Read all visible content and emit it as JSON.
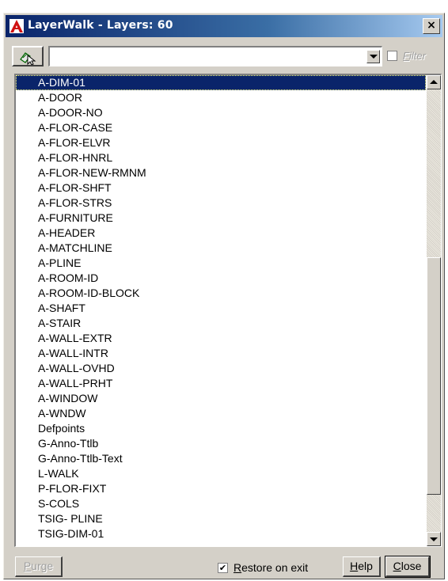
{
  "window": {
    "title": "LayerWalk - Layers: 60",
    "close_glyph": "×"
  },
  "toolbar": {
    "pick_icon": "select-objects-icon",
    "layer_input_value": "",
    "filter": {
      "checked": false,
      "label_first": "F",
      "label_rest": "ilter"
    }
  },
  "layers": {
    "selected_index": 0,
    "items": [
      "A-DIM-01",
      "A-DOOR",
      "A-DOOR-NO",
      "A-FLOR-CASE",
      "A-FLOR-ELVR",
      "A-FLOR-HNRL",
      "A-FLOR-NEW-RMNM",
      "A-FLOR-SHFT",
      "A-FLOR-STRS",
      "A-FURNITURE",
      "A-HEADER",
      "A-MATCHLINE",
      "A-PLINE",
      "A-ROOM-ID",
      "A-ROOM-ID-BLOCK",
      "A-SHAFT",
      "A-STAIR",
      "A-WALL-EXTR",
      "A-WALL-INTR",
      "A-WALL-OVHD",
      "A-WALL-PRHT",
      "A-WINDOW",
      "A-WNDW",
      "Defpoints",
      "G-Anno-Ttlb",
      "G-Anno-Ttlb-Text",
      "L-WALK",
      "P-FLOR-FIXT",
      "S-COLS",
      "TSIG- PLINE",
      "TSIG-DIM-01"
    ]
  },
  "footer": {
    "purge": {
      "first": "P",
      "rest": "urge"
    },
    "restore": {
      "checked": true,
      "check_glyph": "✔",
      "first": "R",
      "rest": "estore on exit"
    },
    "help": {
      "first": "H",
      "rest": "elp"
    },
    "close": {
      "first": "C",
      "rest": "lose"
    }
  },
  "colors": {
    "titlebar_start": "#0a246a",
    "titlebar_end": "#a6caf0",
    "selection": "#0a246a",
    "dialog_face": "#d4d0c8"
  }
}
